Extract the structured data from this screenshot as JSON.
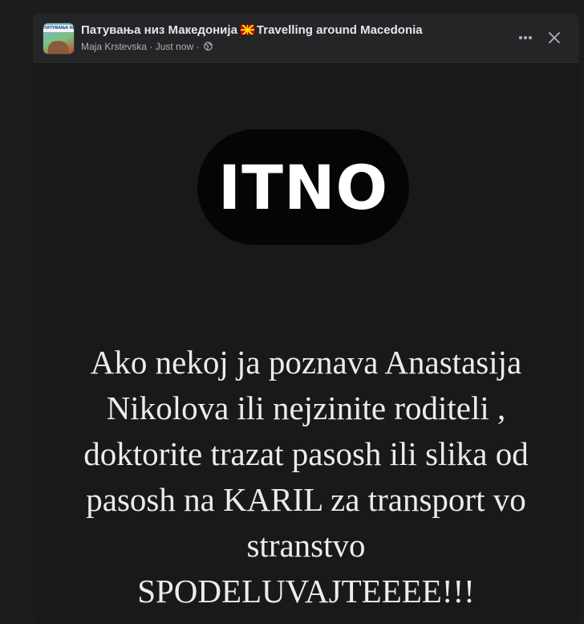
{
  "post": {
    "group_name": "Патувања низ Македонија",
    "group_name_en": "Travelling around Macedonia",
    "avatar_text": "ПАТУВАЊА НИЗ МАКЕДОНИЈА",
    "author": "Maja Krstevska",
    "time": "Just now",
    "separator": "·",
    "privacy_icon": "globe-icon",
    "flag_icon": "macedonia-flag-icon"
  },
  "controls": {
    "more_icon": "more-dots-icon",
    "close_icon": "close-icon"
  },
  "image": {
    "badge_text": "ITNO",
    "lines": [
      "Ako nekoj ja poznava Anastasija",
      "Nikolova ili nejzinite roditeli ,",
      "doktorite trazat pasosh ili slika od",
      "pasosh na KARIL za transport vo",
      "stranstvo",
      "SPODELUVAJTEEEE!!!"
    ]
  },
  "colors": {
    "page_bg": "#1c1c1d",
    "card_bg": "#242526",
    "title_text": "#e4e6eb",
    "meta_text": "#b0b3b8",
    "image_bg": "#191919"
  }
}
